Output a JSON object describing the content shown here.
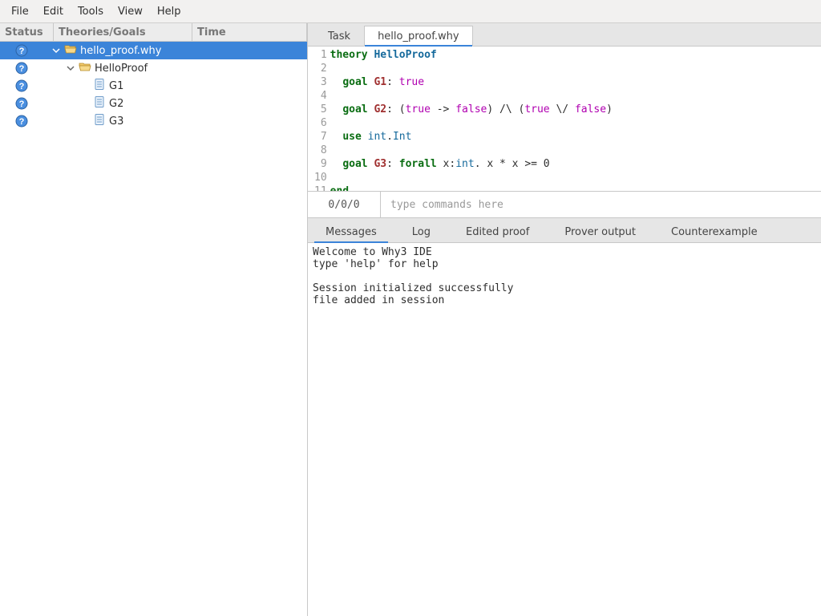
{
  "menu": [
    "File",
    "Edit",
    "Tools",
    "View",
    "Help"
  ],
  "tree_cols": {
    "status": "Status",
    "theories": "Theories/Goals",
    "time": "Time"
  },
  "tree": [
    {
      "level": 0,
      "expanded": true,
      "selected": true,
      "icon": "folder-open-sel",
      "label": "hello_proof.why"
    },
    {
      "level": 1,
      "expanded": true,
      "selected": false,
      "icon": "folder-open",
      "label": "HelloProof"
    },
    {
      "level": 2,
      "expanded": false,
      "selected": false,
      "icon": "doc",
      "label": "G1"
    },
    {
      "level": 2,
      "expanded": false,
      "selected": false,
      "icon": "doc",
      "label": "G2"
    },
    {
      "level": 2,
      "expanded": false,
      "selected": false,
      "icon": "doc",
      "label": "G3"
    }
  ],
  "editor_tabs": [
    {
      "label": "Task",
      "active": false
    },
    {
      "label": "hello_proof.why",
      "active": true
    }
  ],
  "code_lines": [
    [
      {
        "cls": "kw",
        "t": "theory"
      },
      {
        "t": " "
      },
      {
        "cls": "name",
        "t": "HelloProof"
      }
    ],
    [],
    [
      {
        "t": "  "
      },
      {
        "cls": "kw",
        "t": "goal"
      },
      {
        "t": " "
      },
      {
        "cls": "goal",
        "t": "G1"
      },
      {
        "t": ": "
      },
      {
        "cls": "lit",
        "t": "true"
      }
    ],
    [],
    [
      {
        "t": "  "
      },
      {
        "cls": "kw",
        "t": "goal"
      },
      {
        "t": " "
      },
      {
        "cls": "goal",
        "t": "G2"
      },
      {
        "t": ": ("
      },
      {
        "cls": "lit",
        "t": "true"
      },
      {
        "t": " -> "
      },
      {
        "cls": "lit",
        "t": "false"
      },
      {
        "t": ") /\\ ("
      },
      {
        "cls": "lit",
        "t": "true"
      },
      {
        "t": " \\/ "
      },
      {
        "cls": "lit",
        "t": "false"
      },
      {
        "t": ")"
      }
    ],
    [],
    [
      {
        "t": "  "
      },
      {
        "cls": "kw",
        "t": "use"
      },
      {
        "t": " "
      },
      {
        "cls": "ty",
        "t": "int"
      },
      {
        "t": "."
      },
      {
        "cls": "ty",
        "t": "Int"
      }
    ],
    [],
    [
      {
        "t": "  "
      },
      {
        "cls": "kw",
        "t": "goal"
      },
      {
        "t": " "
      },
      {
        "cls": "goal",
        "t": "G3"
      },
      {
        "t": ": "
      },
      {
        "cls": "kw",
        "t": "forall"
      },
      {
        "t": " x:"
      },
      {
        "cls": "ty",
        "t": "int"
      },
      {
        "t": ". x * x >= 0"
      }
    ],
    [],
    [
      {
        "cls": "kw",
        "t": "end"
      }
    ]
  ],
  "counter": "0/0/0",
  "cmd_placeholder": "type commands here",
  "msg_tabs": [
    {
      "label": "Messages",
      "active": true
    },
    {
      "label": "Log",
      "active": false
    },
    {
      "label": "Edited proof",
      "active": false
    },
    {
      "label": "Prover output",
      "active": false
    },
    {
      "label": "Counterexample",
      "active": false
    }
  ],
  "messages_text": "Welcome to Why3 IDE\ntype 'help' for help\n\nSession initialized successfully\nfile added in session"
}
